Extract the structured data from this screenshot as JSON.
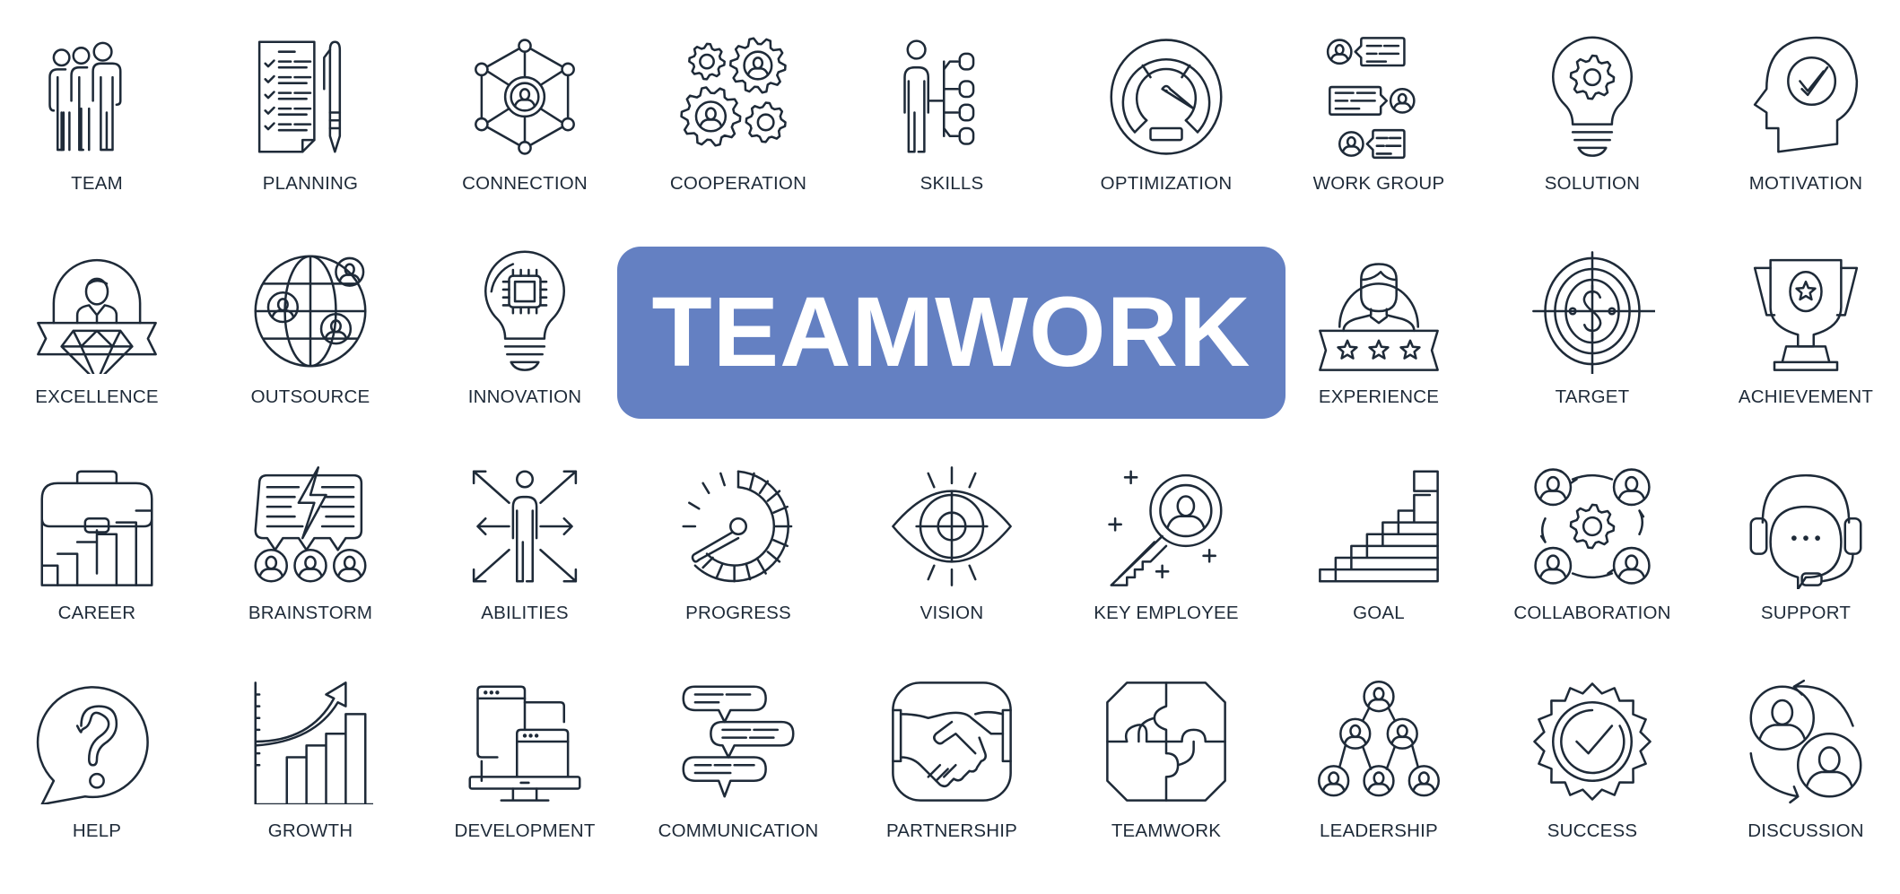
{
  "banner": {
    "title": "TEAMWORK",
    "color": "#6480C2",
    "text_color": "#FFFFFF"
  },
  "icon_color": "#1E2A38",
  "rows": [
    [
      {
        "label": "TEAM",
        "icon": "team-icon"
      },
      {
        "label": "PLANNING",
        "icon": "planning-icon"
      },
      {
        "label": "CONNECTION",
        "icon": "connection-icon"
      },
      {
        "label": "COOPERATION",
        "icon": "cooperation-icon"
      },
      {
        "label": "SKILLS",
        "icon": "skills-icon"
      },
      {
        "label": "OPTIMIZATION",
        "icon": "optimization-icon"
      },
      {
        "label": "WORK GROUP",
        "icon": "work-group-icon"
      },
      {
        "label": "SOLUTION",
        "icon": "solution-icon"
      },
      {
        "label": "MOTIVATION",
        "icon": "motivation-icon"
      }
    ],
    [
      {
        "label": "EXCELLENCE",
        "icon": "excellence-icon"
      },
      {
        "label": "OUTSOURCE",
        "icon": "outsource-icon"
      },
      {
        "label": "INNOVATION",
        "icon": "innovation-icon"
      },
      {
        "label": "EXPERIENCE",
        "icon": "experience-icon"
      },
      {
        "label": "TARGET",
        "icon": "target-icon"
      },
      {
        "label": "ACHIEVEMENT",
        "icon": "achievement-icon"
      }
    ],
    [
      {
        "label": "CAREER",
        "icon": "career-icon"
      },
      {
        "label": "BRAINSTORM",
        "icon": "brainstorm-icon"
      },
      {
        "label": "ABILITIES",
        "icon": "abilities-icon"
      },
      {
        "label": "PROGRESS",
        "icon": "progress-icon"
      },
      {
        "label": "VISION",
        "icon": "vision-icon"
      },
      {
        "label": "KEY EMPLOYEE",
        "icon": "key-employee-icon"
      },
      {
        "label": "GOAL",
        "icon": "goal-icon"
      },
      {
        "label": "COLLABORATION",
        "icon": "collaboration-icon"
      },
      {
        "label": "SUPPORT",
        "icon": "support-icon"
      }
    ],
    [
      {
        "label": "HELP",
        "icon": "help-icon"
      },
      {
        "label": "GROWTH",
        "icon": "growth-icon"
      },
      {
        "label": "DEVELOPMENT",
        "icon": "development-icon"
      },
      {
        "label": "COMMUNICATION",
        "icon": "communication-icon"
      },
      {
        "label": "PARTNERSHIP",
        "icon": "partnership-icon"
      },
      {
        "label": "TEAMWORK",
        "icon": "teamwork-puzzle-icon"
      },
      {
        "label": "LEADERSHIP",
        "icon": "leadership-icon"
      },
      {
        "label": "SUCCESS",
        "icon": "success-icon"
      },
      {
        "label": "DISCUSSION",
        "icon": "discussion-icon"
      }
    ]
  ]
}
